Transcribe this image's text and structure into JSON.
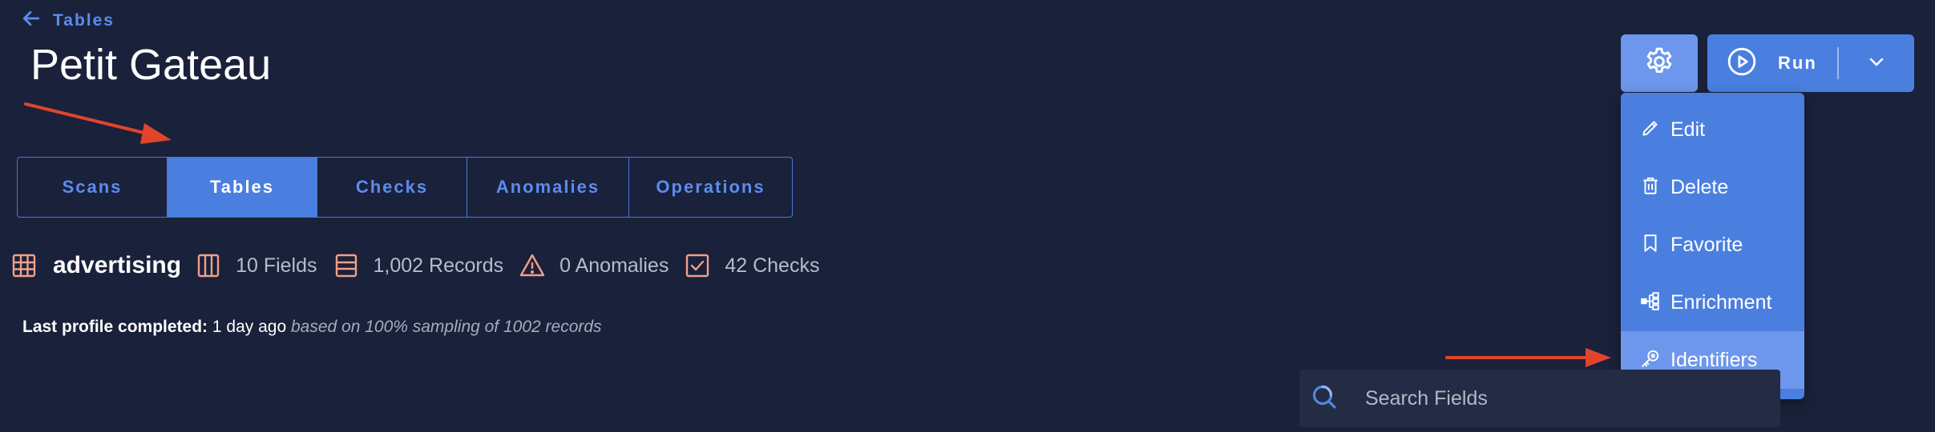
{
  "back_link": {
    "label": "Tables"
  },
  "page_title": "Petit Gateau",
  "tabs": [
    {
      "label": "Scans",
      "active": false
    },
    {
      "label": "Tables",
      "active": true
    },
    {
      "label": "Checks",
      "active": false
    },
    {
      "label": "Anomalies",
      "active": false
    },
    {
      "label": "Operations",
      "active": false
    }
  ],
  "summary": {
    "table_name": "advertising",
    "fields": "10 Fields",
    "records": "1,002 Records",
    "anomalies": "0 Anomalies",
    "checks": "42 Checks",
    "icon_color": "#f0a08a"
  },
  "profile": {
    "label": "Last profile completed:",
    "value": "1 day ago",
    "note": "based on 100% sampling of 1002 records"
  },
  "toolbar": {
    "settings_icon": "gear-icon",
    "run_label": "Run"
  },
  "menu": {
    "items": [
      {
        "label": "Edit",
        "icon": "pencil-icon"
      },
      {
        "label": "Delete",
        "icon": "trash-icon"
      },
      {
        "label": "Favorite",
        "icon": "bookmark-icon"
      },
      {
        "label": "Enrichment",
        "icon": "hierarchy-icon"
      },
      {
        "label": "Identifiers",
        "icon": "key-icon",
        "highlighted": true
      }
    ]
  },
  "search": {
    "placeholder": "Search Fields",
    "value": ""
  },
  "colors": {
    "background": "#1a213a",
    "accent": "#4a7fe0",
    "accent_light": "#6d97ec",
    "annotation_arrow": "#e0452c"
  }
}
